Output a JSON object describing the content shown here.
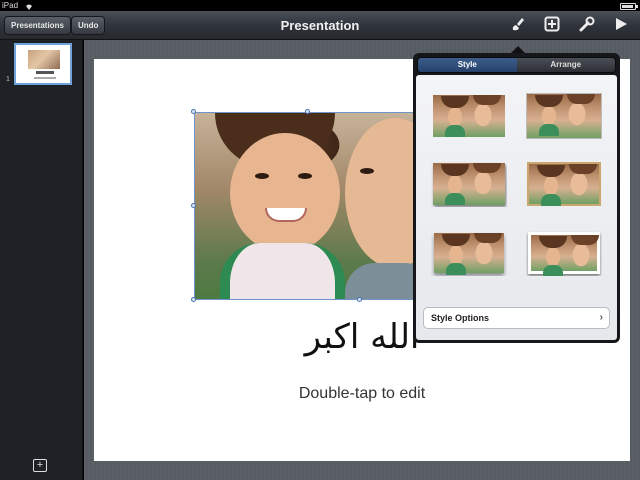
{
  "status": {
    "device": "iPad",
    "time": "",
    "wifi_icon": "wifi-icon",
    "battery_icon": "battery-icon"
  },
  "toolbar": {
    "presentations_label": "Presentations",
    "undo_label": "Undo",
    "title": "Presentation",
    "icons": [
      "brush-icon",
      "insert-icon",
      "wrench-icon",
      "play-icon"
    ]
  },
  "navigator": {
    "slide_number": "1"
  },
  "slide": {
    "title_text": "الله اكبر",
    "subtitle_text": "Double-tap to edit"
  },
  "popover": {
    "tabs": [
      {
        "label": "Style",
        "active": true
      },
      {
        "label": "Arrange",
        "active": false
      }
    ],
    "style_presets_count": 6,
    "style_options_label": "Style Options"
  },
  "colors": {
    "toolbar": "#2e3239",
    "selection": "#4a74b3",
    "active_tab": "#25416b"
  }
}
